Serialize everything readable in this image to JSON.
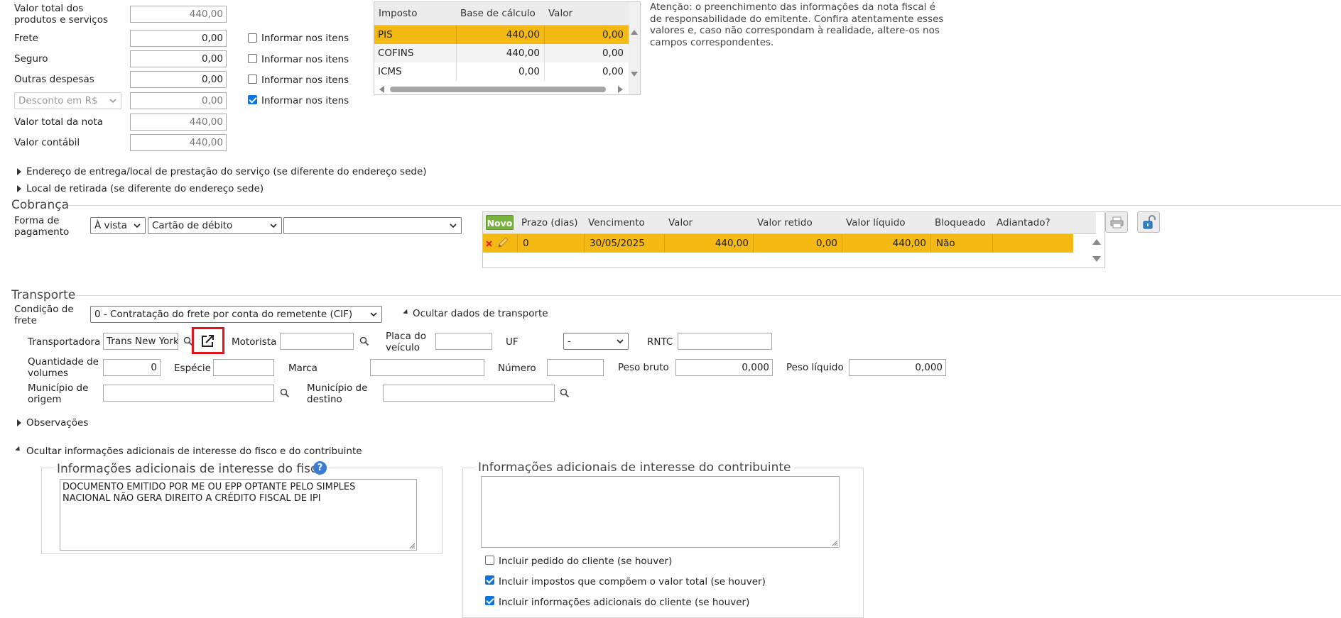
{
  "totals": {
    "valor_total_produtos_label": "Valor total dos produtos e serviços",
    "valor_total_produtos": "440,00",
    "frete_label": "Frete",
    "frete": "0,00",
    "seguro_label": "Seguro",
    "seguro": "0,00",
    "outras_despesas_label": "Outras despesas",
    "outras_despesas": "0,00",
    "desconto_select": "Desconto em R$",
    "desconto": "0,00",
    "valor_total_nota_label": "Valor total da nota",
    "valor_total_nota": "440,00",
    "valor_contabil_label": "Valor contábil",
    "valor_contabil": "440,00",
    "informar_label": "Informar nos itens"
  },
  "tax_table": {
    "headers": [
      "Imposto",
      "Base de cálculo",
      "Valor"
    ],
    "rows": [
      [
        "PIS",
        "440,00",
        "0,00"
      ],
      [
        "COFINS",
        "440,00",
        "0,00"
      ],
      [
        "ICMS",
        "0,00",
        "0,00"
      ]
    ]
  },
  "notice": "Atenção: o preenchimento das informações da nota fiscal é de responsabilidade do emitente. Confira atentamente esses valores e, caso não correspondam à realidade, altere-os nos campos correspondentes.",
  "expanders": {
    "endereco_entrega": "Endereço de entrega/local de prestação do serviço (se diferente do endereço sede)",
    "local_retirada": "Local de retirada (se diferente do endereço sede)",
    "observacoes": "Observações",
    "ocultar_info": "Ocultar informações adicionais de interesse do fisco e do contribuinte"
  },
  "cobranca": {
    "title": "Cobrança",
    "forma_label": "Forma de pagamento",
    "forma_select1": "À vista",
    "forma_select2": "Cartão de débito",
    "forma_select3": "",
    "novo": "Novo",
    "headers": [
      "Prazo (dias)",
      "Vencimento",
      "Valor",
      "Valor retido",
      "Valor líquido",
      "Bloqueado",
      "Adiantado?"
    ],
    "rows": [
      [
        "0",
        "30/05/2025",
        "440,00",
        "0,00",
        "440,00",
        "Não",
        ""
      ]
    ]
  },
  "transporte": {
    "title": "Transporte",
    "condicao_label": "Condição de frete",
    "condicao_value": "0 - Contratação do frete por conta do remetente (CIF)",
    "ocultar_dados": "Ocultar dados de transporte",
    "transportadora_label": "Transportadora",
    "transportadora_value": "Trans New York",
    "motorista_label": "Motorista",
    "motorista_value": "",
    "placa_label": "Placa do veículo",
    "placa_value": "",
    "uf_label": "UF",
    "uf_value": "-",
    "rntc_label": "RNTC",
    "rntc_value": "",
    "qtd_volumes_label": "Quantidade de volumes",
    "qtd_volumes_value": "0",
    "especie_label": "Espécie",
    "especie_value": "",
    "marca_label": "Marca",
    "marca_value": "",
    "numero_label": "Número",
    "numero_value": "",
    "peso_bruto_label": "Peso bruto",
    "peso_bruto_value": "0,000",
    "peso_liquido_label": "Peso líquido",
    "peso_liquido_value": "0,000",
    "municipio_origem_label": "Município de origem",
    "municipio_origem_value": "",
    "municipio_destino_label": "Município de destino",
    "municipio_destino_value": ""
  },
  "info_adicionais": {
    "fisco_title": "Informações adicionais de interesse do fisco",
    "fisco_text": "DOCUMENTO EMITIDO POR ME OU EPP OPTANTE PELO SIMPLES\nNACIONAL NÃO GERA DIREITO A CRÉDITO FISCAL DE IPI",
    "contribuinte_title": "Informações adicionais de interesse do contribuinte",
    "contribuinte_text": "",
    "incluir_pedido": "Incluir pedido do cliente (se houver)",
    "incluir_impostos": "Incluir impostos que compõem o valor total (se houver)",
    "incluir_info_cliente": "Incluir informações adicionais do cliente (se houver)"
  },
  "colors": {
    "highlight": "#f5b914",
    "novo_green": "#78b43c",
    "focus_red": "#e0161c",
    "checkbox_blue": "#0b74de"
  }
}
